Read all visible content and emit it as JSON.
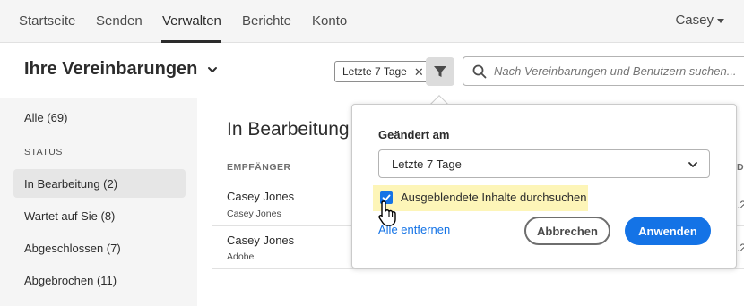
{
  "nav": {
    "items": [
      "Startseite",
      "Senden",
      "Verwalten",
      "Berichte",
      "Konto"
    ],
    "active": "Verwalten",
    "user": "Casey"
  },
  "header": {
    "title": "Ihre Vereinbarungen",
    "filter_tag": "Letzte 7 Tage",
    "search_placeholder": "Nach Vereinbarungen und Benutzern suchen..."
  },
  "sidebar": {
    "all": "Alle (69)",
    "section_label": "STATUS",
    "items": [
      {
        "label": "In Bearbeitung (2)",
        "selected": true
      },
      {
        "label": "Wartet auf Sie (8)",
        "selected": false
      },
      {
        "label": "Abgeschlossen (7)",
        "selected": false
      },
      {
        "label": "Abgebrochen (11)",
        "selected": false
      }
    ]
  },
  "list": {
    "title": "In Bearbeitung",
    "column_header": "EMPFÄNGER",
    "column_header_right": "D",
    "rows": [
      {
        "name": "Casey Jones",
        "sub": "Casey Jones",
        "right": ".2"
      },
      {
        "name": "Casey Jones",
        "sub": "Adobe",
        "right": ".2"
      }
    ]
  },
  "popover": {
    "field_label": "Geändert am",
    "select_value": "Letzte 7 Tage",
    "checkbox_label": "Ausgeblendete Inhalte durchsuchen",
    "checkbox_checked": true,
    "clear_link": "Alle entfernen",
    "cancel_label": "Abbrechen",
    "apply_label": "Anwenden"
  },
  "colors": {
    "accent": "#1473e6",
    "highlight": "#fdf5b8",
    "nav_bg": "#f5f5f5"
  },
  "icons": [
    "filter-icon",
    "search-icon",
    "chevron-down-icon",
    "close-icon",
    "checkmark-icon",
    "hand-cursor-icon"
  ]
}
